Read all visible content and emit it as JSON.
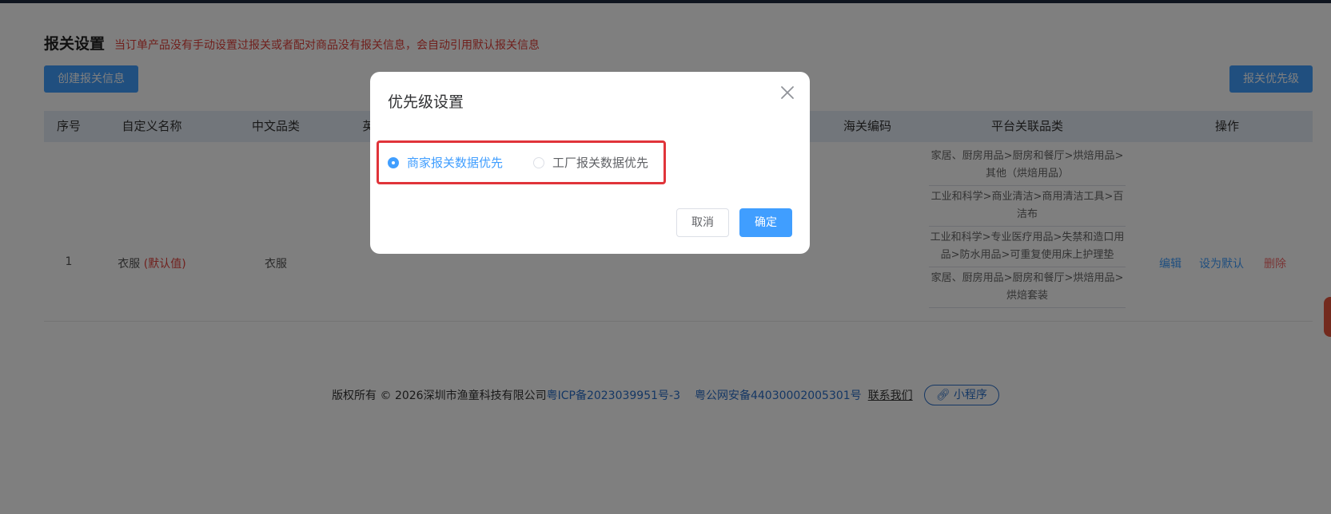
{
  "page": {
    "title": "报关设置",
    "hint": "当订单产品没有手动设置过报关或者配对商品没有报关信息，会自动引用默认报关信息",
    "create_button": "创建报关信息",
    "priority_button": "报关优先级"
  },
  "table": {
    "headers": {
      "index": "序号",
      "custom_name": "自定义名称",
      "cn_category": "中文品类",
      "en_category_partial": "英",
      "hs_code": "海关编码",
      "platform_category": "平台关联品类",
      "actions": "操作"
    },
    "rows": [
      {
        "index": "1",
        "custom_name": "衣服",
        "default_tag": "(默认值)",
        "cn_category": "衣服",
        "platform_categories": [
          "家居、厨房用品>厨房和餐厅>烘焙用品>其他（烘焙用品）",
          "工业和科学>商业清洁>商用清洁工具>百洁布",
          "工业和科学>专业医疗用品>失禁和造口用品>防水用品>可重复使用床上护理垫",
          "家居、厨房用品>厨房和餐厅>烘焙用品>烘焙套装"
        ],
        "actions": {
          "edit": "编辑",
          "set_default": "设为默认",
          "delete": "删除"
        }
      }
    ]
  },
  "footer": {
    "copyright": "版权所有 © 2026深圳市渔童科技有限公司",
    "icp": "粤ICP备2023039951号-3",
    "police": "粤公网安备44030002005301号",
    "contact": "联系我们",
    "mini_program": "小程序"
  },
  "dialog": {
    "title": "优先级设置",
    "options": [
      {
        "label": "商家报关数据优先",
        "selected": true
      },
      {
        "label": "工厂报关数据优先",
        "selected": false
      }
    ],
    "cancel": "取消",
    "confirm": "确定"
  },
  "colors": {
    "primary": "#409eff",
    "danger": "#f56c6c",
    "hint_red": "#e0403a",
    "highlight_border": "#e0343a",
    "table_header_bg": "#e5ecf6"
  },
  "icons": {
    "close": "close-icon",
    "mini_program": "link-icon"
  }
}
